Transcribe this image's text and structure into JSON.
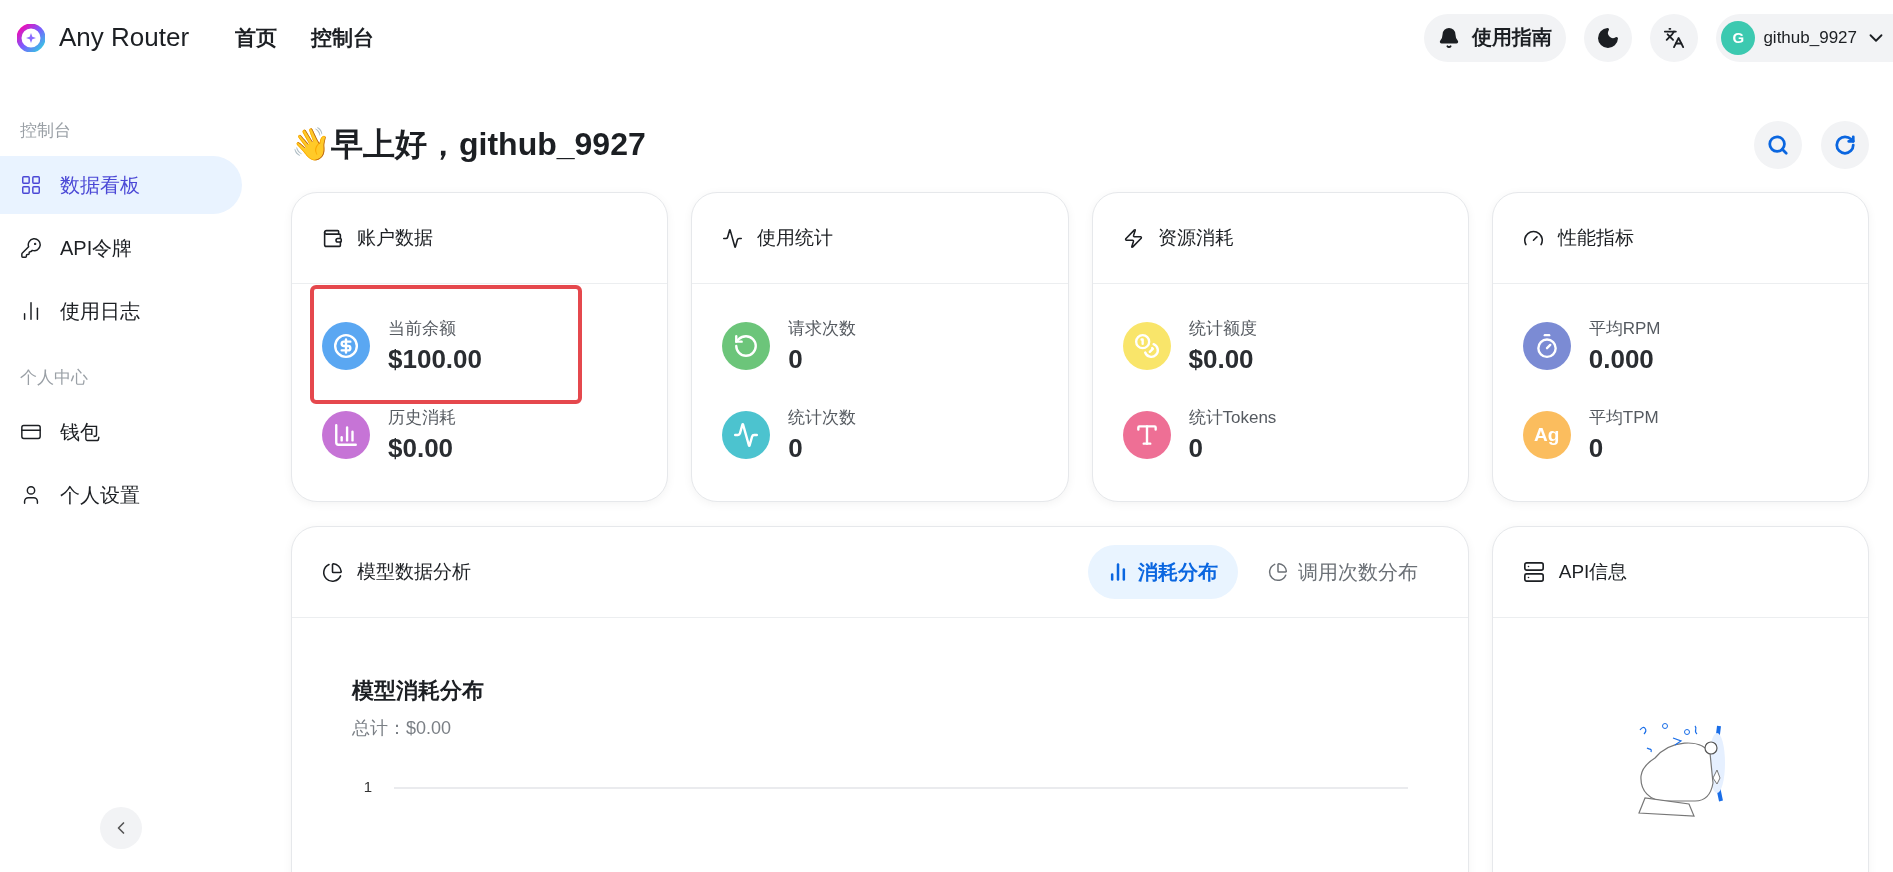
{
  "header": {
    "brand": "Any Router",
    "nav": [
      {
        "label": "首页"
      },
      {
        "label": "控制台"
      }
    ],
    "guide_button": "使用指南",
    "user": {
      "avatar": "G",
      "name": "github_9927"
    }
  },
  "sidebar": {
    "sections": [
      {
        "label": "控制台",
        "items": [
          {
            "label": "数据看板",
            "selected": true
          },
          {
            "label": "API令牌",
            "selected": false
          },
          {
            "label": "使用日志",
            "selected": false
          }
        ]
      },
      {
        "label": "个人中心",
        "items": [
          {
            "label": "钱包",
            "selected": false
          },
          {
            "label": "个人设置",
            "selected": false
          }
        ]
      }
    ]
  },
  "greeting": {
    "emoji": "👋",
    "text": "早上好，github_9927"
  },
  "cards": [
    {
      "title": "账户数据",
      "stats": [
        {
          "label": "当前余额",
          "value": "$100.00",
          "color": "#5aa7f2",
          "highlight": true
        },
        {
          "label": "历史消耗",
          "value": "$0.00",
          "color": "#c674d6",
          "highlight": false
        }
      ]
    },
    {
      "title": "使用统计",
      "stats": [
        {
          "label": "请求次数",
          "value": "0",
          "color": "#6cc57a",
          "highlight": false
        },
        {
          "label": "统计次数",
          "value": "0",
          "color": "#4cc3cf",
          "highlight": false
        }
      ]
    },
    {
      "title": "资源消耗",
      "stats": [
        {
          "label": "统计额度",
          "value": "$0.00",
          "color": "#f9e56a",
          "highlight": false
        },
        {
          "label": "统计Tokens",
          "value": "0",
          "color": "#ee6f95",
          "highlight": false
        }
      ]
    },
    {
      "title": "性能指标",
      "stats": [
        {
          "label": "平均RPM",
          "value": "0.000",
          "color": "#7b8bd4",
          "highlight": false
        },
        {
          "label": "平均TPM",
          "value": "0",
          "color": "#fbbd5e",
          "highlight": false,
          "badge": "Ag"
        }
      ]
    }
  ],
  "analysis": {
    "title": "模型数据分析",
    "tabs": [
      {
        "label": "消耗分布",
        "selected": true
      },
      {
        "label": "调用次数分布",
        "selected": false
      }
    ],
    "chart_title": "模型消耗分布",
    "total": "总计：$0.00",
    "axis_ticks": [
      "1"
    ]
  },
  "api_info": {
    "title": "API信息"
  }
}
